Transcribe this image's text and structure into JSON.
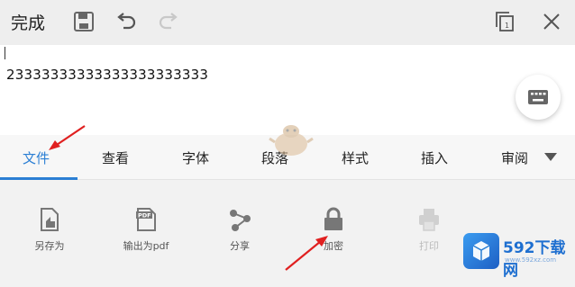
{
  "toolbar": {
    "done_label": "完成",
    "icons": [
      "save-icon",
      "undo-icon",
      "redo-icon",
      "multiwindow-icon",
      "close-icon"
    ]
  },
  "document": {
    "text": "23333333333333333333333"
  },
  "tabs": [
    {
      "label": "文件",
      "active": true
    },
    {
      "label": "查看",
      "active": false
    },
    {
      "label": "字体",
      "active": false
    },
    {
      "label": "段落",
      "active": false
    },
    {
      "label": "样式",
      "active": false
    },
    {
      "label": "插入",
      "active": false
    },
    {
      "label": "审阅",
      "active": false
    }
  ],
  "tools": [
    {
      "label": "另存为",
      "icon": "save-as-icon",
      "enabled": true
    },
    {
      "label": "输出为pdf",
      "icon": "pdf-icon",
      "enabled": true
    },
    {
      "label": "分享",
      "icon": "share-icon",
      "enabled": true
    },
    {
      "label": "加密",
      "icon": "lock-icon",
      "enabled": true
    },
    {
      "label": "打印",
      "icon": "print-icon",
      "enabled": false
    }
  ],
  "watermark": {
    "title": "592下载网",
    "url": "www.592xz.com"
  },
  "colors": {
    "accent": "#2b7fd4",
    "annotation_arrow": "#e02020"
  }
}
